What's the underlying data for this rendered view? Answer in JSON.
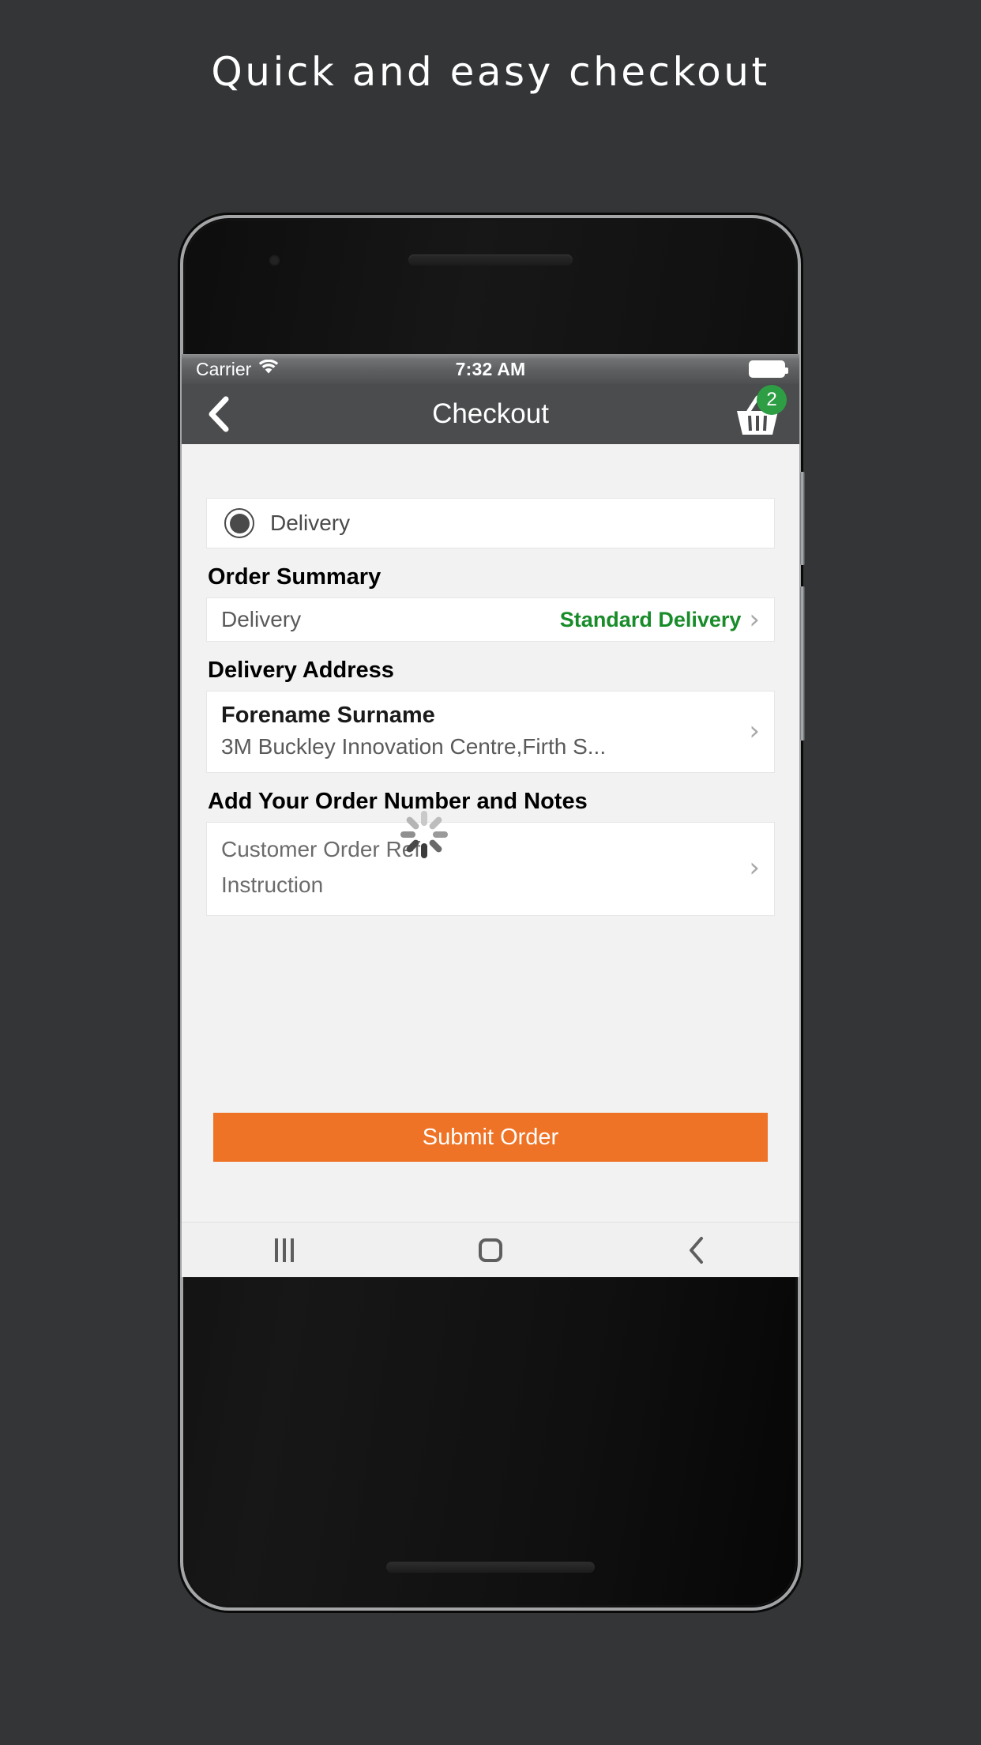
{
  "headline": "Quick and easy checkout",
  "status_bar": {
    "carrier": "Carrier",
    "wifi_icon": "wifi-icon",
    "time": "7:32 AM",
    "battery_icon": "battery-full-icon"
  },
  "navbar": {
    "back_icon": "chevron-left-icon",
    "title": "Checkout",
    "cart_icon": "shopping-basket-icon",
    "cart_count": "2",
    "cart_badge_color": "#2e9e45"
  },
  "delivery_option": {
    "radio_icon": "radio-selected-icon",
    "label": "Delivery",
    "selected": true
  },
  "order_summary": {
    "header": "Order Summary",
    "rows": [
      {
        "label": "Delivery",
        "value": "Standard Delivery",
        "value_color": "#198c2a",
        "chevron": "›"
      }
    ]
  },
  "delivery_address": {
    "header": "Delivery Address",
    "name": "Forename Surname",
    "address": "3M Buckley Innovation Centre,Firth S...",
    "chevron": "›"
  },
  "order_notes": {
    "header": "Add Your Order Number and Notes",
    "lines": [
      "Customer Order Ref",
      "Instruction"
    ],
    "chevron": "›",
    "spinner_icon": "loading-spinner-icon"
  },
  "submit": {
    "label": "Submit Order",
    "color": "#ef7326"
  },
  "android_nav": {
    "recents_icon": "recents-icon",
    "home_icon": "home-icon",
    "back_icon": "back-chevron-icon"
  }
}
